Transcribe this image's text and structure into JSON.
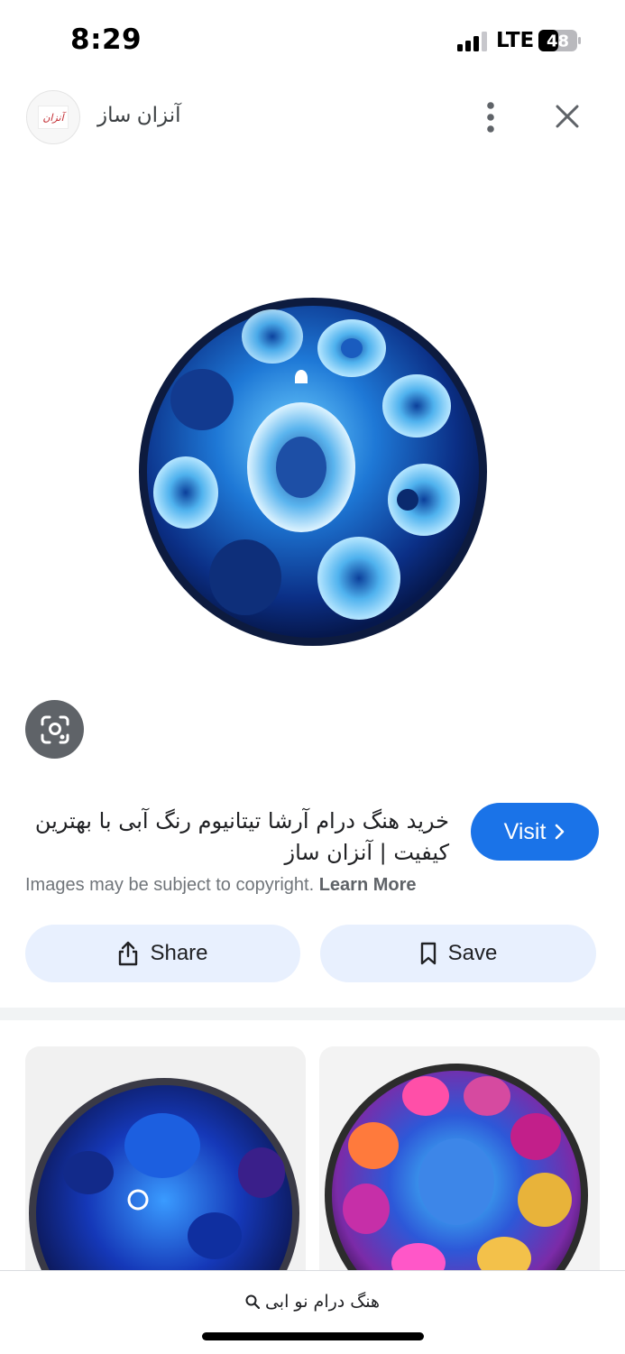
{
  "status_bar": {
    "time": "8:29",
    "network": "LTE",
    "battery": "48"
  },
  "header": {
    "source_name": "آنزان ساز",
    "logo_text": "آنزان"
  },
  "result": {
    "title": "خرید هنگ درام آرشا تیتانیوم رنگ آبی با بهترین کیفیت | آنزان ساز",
    "visit_label": "Visit",
    "copyright_text": "Images may be subject to copyright.",
    "learn_more_label": "Learn More"
  },
  "actions": {
    "share_label": "Share",
    "save_label": "Save"
  },
  "bottom": {
    "query": "هنگ درام نو ابی"
  },
  "colors": {
    "accent": "#1a73e8",
    "pill": "#e8f0fe",
    "lens": "#5f6368"
  },
  "icons": [
    "more-vert-icon",
    "close-icon",
    "lens-icon",
    "share-icon",
    "bookmark-icon",
    "chevron-right-icon",
    "search-icon"
  ]
}
